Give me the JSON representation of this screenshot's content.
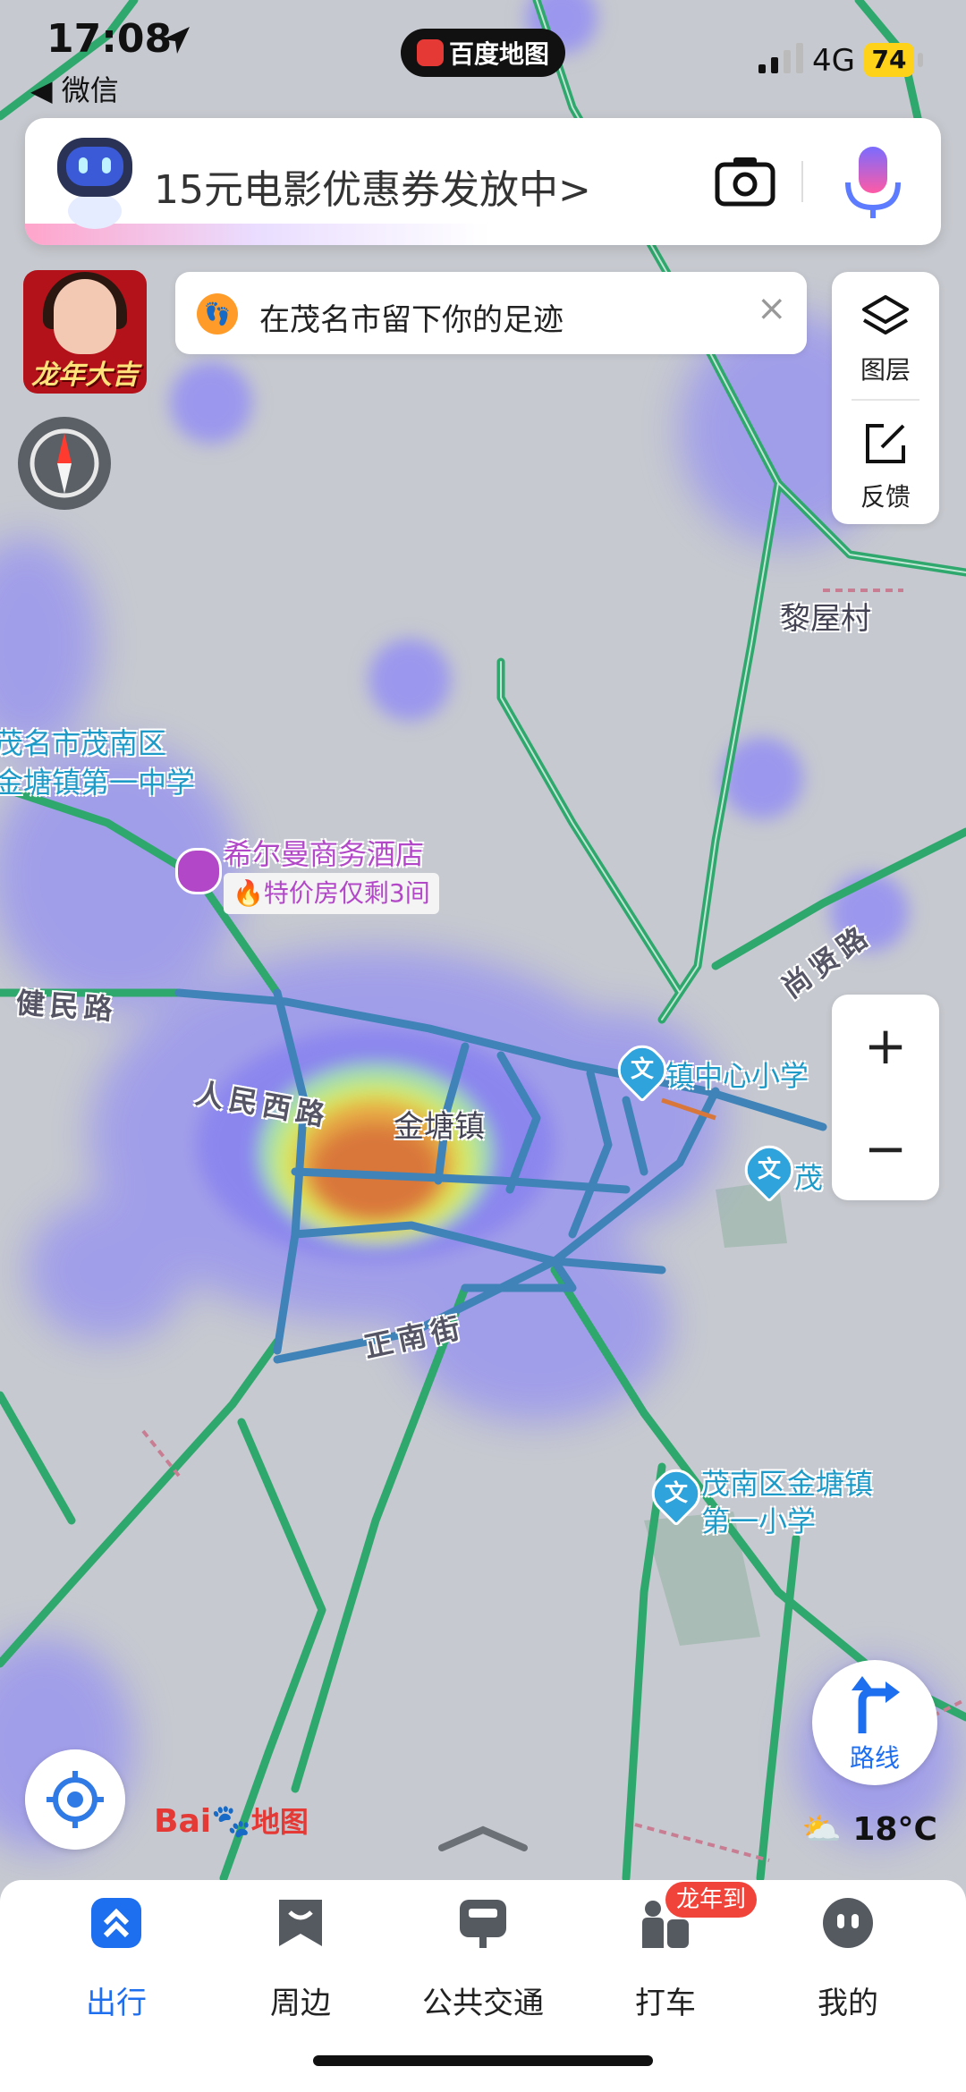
{
  "status_bar": {
    "time": "17:08",
    "back_app": "◀ 微信",
    "app_pill": "百度地图",
    "network": "4G",
    "battery": "74"
  },
  "search": {
    "placeholder": "15元电影优惠券发放中>"
  },
  "toast": {
    "text": "在茂名市留下你的足迹"
  },
  "promo": {
    "text": "龙年大吉"
  },
  "right_panel": {
    "layers_label": "图层",
    "feedback_label": "反馈"
  },
  "zoom": {
    "in": "+",
    "out": "−"
  },
  "map_labels": {
    "village": "黎屋村",
    "school_top": "茂名市茂南区金塘镇第一中学",
    "school_top_line1": "茂名市茂南区",
    "school_top_line2": "金塘镇第一中学",
    "hotel": "希尔曼商务酒店",
    "hotel_deal": "特价房仅剩3间",
    "road_jianmin": "健民路",
    "road_renminxi": "人民西路",
    "town": "金塘镇",
    "road_zhengnan": "正南街",
    "road_shangxian": "尚贤路",
    "school_center": "镇中心小学",
    "school_right": "茂",
    "school_bottom_line1": "茂南区金塘镇",
    "school_bottom_line2": "第一小学",
    "edu_pin_glyph": "文"
  },
  "controls": {
    "route_label": "路线",
    "weather": "18°C",
    "logo_text": "Bai",
    "logo_map": "地图"
  },
  "tabs": [
    {
      "label": "出行",
      "icon": "travel-icon",
      "active": true
    },
    {
      "label": "周边",
      "icon": "nearby-icon",
      "active": false
    },
    {
      "label": "公共交通",
      "icon": "bus-icon",
      "active": false
    },
    {
      "label": "打车",
      "icon": "taxi-icon",
      "active": false
    },
    {
      "label": "我的",
      "icon": "profile-icon",
      "active": false
    }
  ],
  "taxi_badge": "龙年到",
  "colors": {
    "road_green": "#2fa86e",
    "road_blue": "#3f83b8",
    "accent_blue": "#1e6ef0",
    "heat_core": "#d9773a"
  }
}
